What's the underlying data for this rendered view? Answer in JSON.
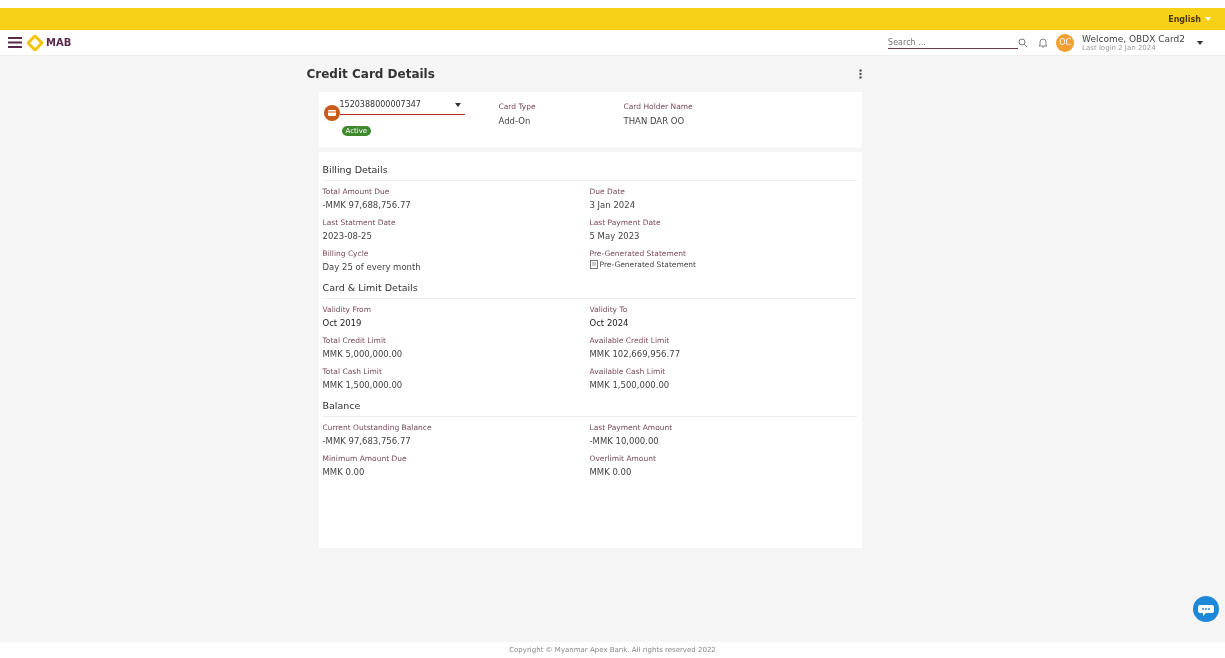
{
  "top_bar": {
    "language": "English"
  },
  "header": {
    "logo": "MAB",
    "search": {
      "placeholder": "Search ..."
    },
    "avatar": "OC",
    "welcome": "Welcome, OBDX Card2",
    "last_login": "Last login 2 Jan 2024"
  },
  "page_title": "Credit Card Details",
  "card": {
    "number": "1520388000007347",
    "status": "Active",
    "fields": [
      {
        "label": "Card Type",
        "value": "Add-On"
      },
      {
        "label": "Card Holder Name",
        "value": "THAN DAR OO"
      }
    ]
  },
  "sections": [
    {
      "title": "Billing Details",
      "fields": [
        {
          "label": "Total Amount Due",
          "value": "-MMK 97,688,756.77",
          "kind": "text"
        },
        {
          "label": "Due Date",
          "value": "3 Jan 2024",
          "kind": "text"
        },
        {
          "label": "Last Statment Date",
          "value": "2023-08-25",
          "kind": "text"
        },
        {
          "label": "Last Payment Date",
          "value": "5 May 2023",
          "kind": "text"
        },
        {
          "label": "Billing Cycle",
          "value": "Day 25 of every month",
          "kind": "text"
        },
        {
          "label": "Pre-Generated Statement",
          "value": "Pre-Generated Statement",
          "kind": "link"
        }
      ]
    },
    {
      "title": "Card & Limit Details",
      "fields": [
        {
          "label": "Validity From",
          "value": "Oct 2019",
          "kind": "strong"
        },
        {
          "label": "Validity To",
          "value": "Oct 2024",
          "kind": "strong"
        },
        {
          "label": "Total Credit Limit",
          "value": "MMK 5,000,000.00",
          "kind": "text"
        },
        {
          "label": "Available Credit Limit",
          "value": "MMK 102,669,956.77",
          "kind": "text"
        },
        {
          "label": "Total Cash Limit",
          "value": "MMK 1,500,000.00",
          "kind": "text"
        },
        {
          "label": "Available Cash Limit",
          "value": "MMK 1,500,000.00",
          "kind": "text"
        }
      ]
    },
    {
      "title": "Balance",
      "fields": [
        {
          "label": "Current Outstanding Balance",
          "value": "-MMK 97,683,756.77",
          "kind": "text"
        },
        {
          "label": "Last Payment Amount",
          "value": "-MMK 10,000.00",
          "kind": "text"
        },
        {
          "label": "Minimum Amount Due",
          "value": "MMK 0.00",
          "kind": "text"
        },
        {
          "label": "Overlimit Amount",
          "value": "MMK 0.00",
          "kind": "text"
        }
      ]
    }
  ],
  "footer": "Copyright © Myanmar Apex Bank. All rights reserved 2022"
}
